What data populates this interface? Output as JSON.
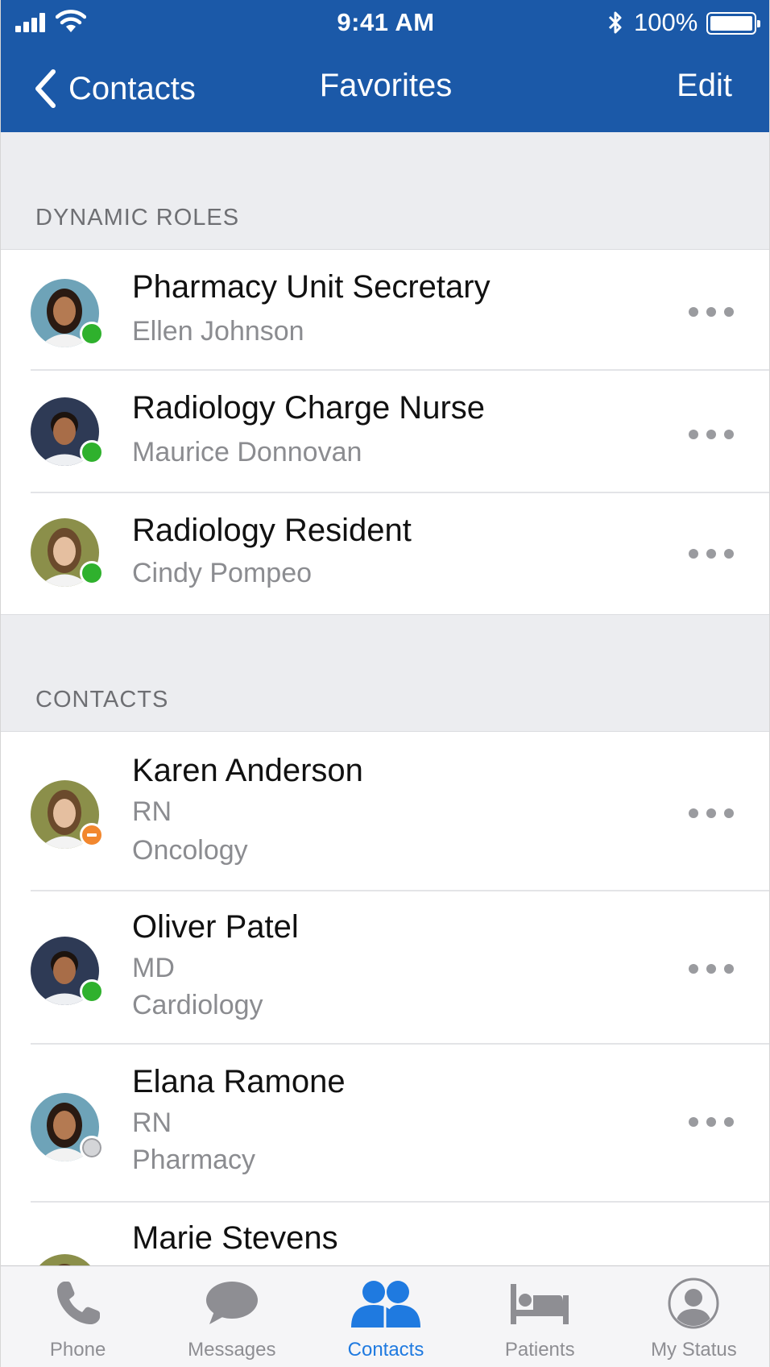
{
  "status_bar": {
    "time": "9:41 AM",
    "battery_percent": "100%",
    "signal_icon": "cellular-signal-icon",
    "wifi_icon": "wifi-icon",
    "bluetooth_icon": "bluetooth-icon",
    "battery_icon": "battery-icon"
  },
  "nav": {
    "back_label": "Contacts",
    "title": "Favorites",
    "edit_label": "Edit"
  },
  "colors": {
    "header_bg": "#1b59a8",
    "available": "#2fb12d",
    "busy": "#f2872e",
    "offline": "#d4d5d8",
    "tab_active": "#1f7ae0",
    "tab_inactive": "#8e8e93"
  },
  "dynamic_roles": {
    "header": "DYNAMIC ROLES",
    "items": [
      {
        "title": "Pharmacy Unit Secretary",
        "subtitle": "Ellen Johnson",
        "presence": "available",
        "avatar": "woman-avatar"
      },
      {
        "title": "Radiology Charge Nurse",
        "subtitle": "Maurice Donnovan",
        "presence": "available",
        "avatar": "man-avatar"
      },
      {
        "title": "Radiology Resident",
        "subtitle": "Cindy Pompeo",
        "presence": "available",
        "avatar": "woman-avatar"
      }
    ]
  },
  "contacts": {
    "header": "CONTACTS",
    "items": [
      {
        "name": "Karen Anderson",
        "role": "RN",
        "department": "Oncology",
        "presence": "busy",
        "avatar": "woman-avatar"
      },
      {
        "name": "Oliver Patel",
        "role": "MD",
        "department": "Cardiology",
        "presence": "available",
        "avatar": "man-avatar"
      },
      {
        "name": "Elana Ramone",
        "role": "RN",
        "department": "Pharmacy",
        "presence": "offline",
        "avatar": "woman-avatar"
      },
      {
        "name": "Marie Stevens",
        "avatar": "woman-avatar"
      }
    ]
  },
  "tab_bar": {
    "active": "contacts",
    "tabs": [
      {
        "id": "phone",
        "label": "Phone",
        "icon": "phone-icon"
      },
      {
        "id": "messages",
        "label": "Messages",
        "icon": "message-bubble-icon"
      },
      {
        "id": "contacts",
        "label": "Contacts",
        "icon": "people-icon"
      },
      {
        "id": "patients",
        "label": "Patients",
        "icon": "bed-icon"
      },
      {
        "id": "my_status",
        "label": "My Status",
        "icon": "user-circle-icon"
      }
    ]
  }
}
